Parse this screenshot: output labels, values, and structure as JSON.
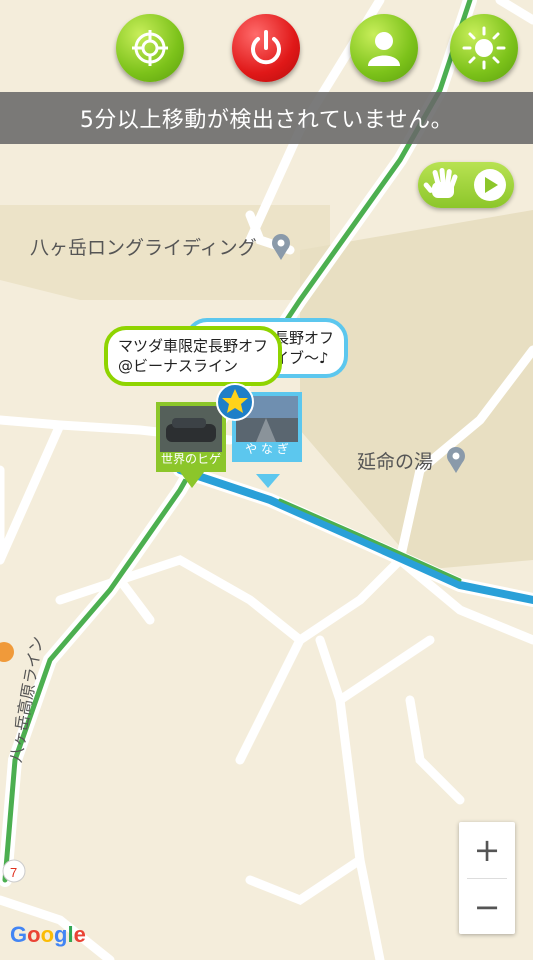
{
  "top_buttons": [
    {
      "icon": "crosshair-icon",
      "color": "#8cc62a"
    },
    {
      "icon": "power-icon",
      "color": "#e01818"
    },
    {
      "icon": "user-icon",
      "color": "#8cc62a"
    },
    {
      "icon": "sun-icon",
      "color": "#8cc62a"
    }
  ],
  "status_message": "5分以上移動が検出されていません。",
  "map": {
    "places": [
      {
        "name": "八ヶ岳ロングライディング"
      },
      {
        "name": "延命の湯"
      }
    ],
    "road_label": "八ヶ岳高原ライン",
    "google_logo": "Google"
  },
  "bubbles": {
    "front": {
      "line1": "マツダ車限定長野オフ",
      "line2": "@ビーナスライン"
    },
    "back": {
      "line1": "定長野オフ",
      "line2": "ライブ〜♪"
    }
  },
  "markers": {
    "front": {
      "caption": "世界のヒゲ"
    },
    "back": {
      "caption": "や な ぎ"
    }
  },
  "zoom": {
    "in": "+",
    "out": "−"
  },
  "colors": {
    "accent": "#8cc62a",
    "route": "#4caf50",
    "route_blue": "#2aa0d8",
    "status_bg": "#696969"
  }
}
